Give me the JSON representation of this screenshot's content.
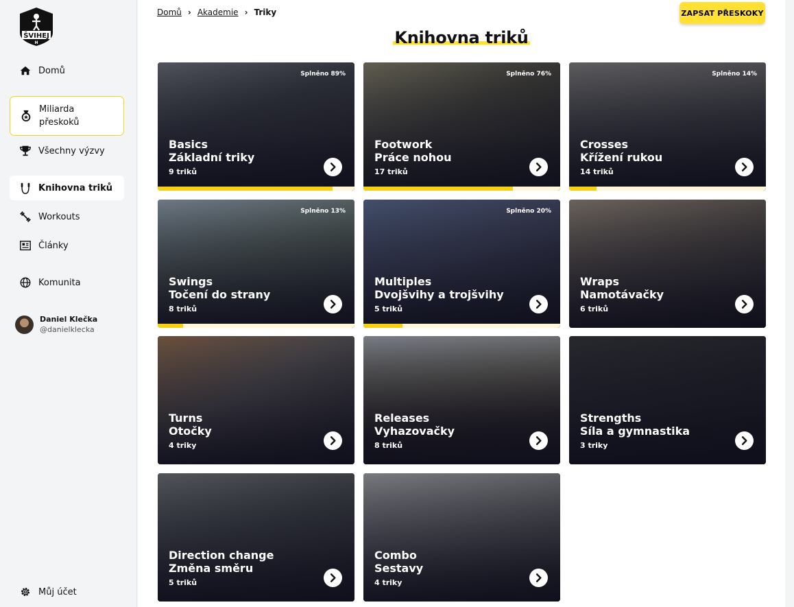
{
  "brand": {
    "logo_text": "ŠVIHEJ"
  },
  "sidebar": {
    "items": [
      {
        "label": "Domů",
        "icon": "home-icon"
      },
      {
        "label": "Miliarda přeskoků",
        "icon": "medal-icon"
      },
      {
        "label": "Všechny výzvy",
        "icon": "trophy-icon"
      },
      {
        "label": "Knihovna triků",
        "icon": "jump-rope-icon"
      },
      {
        "label": "Workouts",
        "icon": "dumbbell-icon"
      },
      {
        "label": "Články",
        "icon": "newspaper-icon"
      },
      {
        "label": "Komunita",
        "icon": "globe-icon"
      }
    ],
    "profile": {
      "name": "Daniel Klečka",
      "handle": "@danielklecka"
    },
    "account": {
      "label": "Můj účet",
      "icon": "settings-icon"
    }
  },
  "breadcrumb": {
    "home": "Domů",
    "academy": "Akademie",
    "current": "Triky"
  },
  "header": {
    "cta_label": "ZAPSAT PŘESKOKY",
    "title": "Knihovna triků"
  },
  "colors": {
    "accent": "#ffe033",
    "progress": "#f7cf13",
    "card_dark": "#15151f"
  },
  "cards": [
    {
      "title_en": "Basics",
      "title_cz": "Základní triky",
      "count": "9 triků",
      "progress_label": "Splněno 89%",
      "progress": 0.89
    },
    {
      "title_en": "Footwork",
      "title_cz": "Práce nohou",
      "count": "17 triků",
      "progress_label": "Splněno 76%",
      "progress": 0.76
    },
    {
      "title_en": "Crosses",
      "title_cz": "Křížení rukou",
      "count": "14 triků",
      "progress_label": "Splněno 14%",
      "progress": 0.14
    },
    {
      "title_en": "Swings",
      "title_cz": "Točení do strany",
      "count": "8 triků",
      "progress_label": "Splněno 13%",
      "progress": 0.13
    },
    {
      "title_en": "Multiples",
      "title_cz": "Dvojšvihy a trojšvihy",
      "count": "5 triků",
      "progress_label": "Splněno 20%",
      "progress": 0.2
    },
    {
      "title_en": "Wraps",
      "title_cz": "Namotávačky",
      "count": "6 triků",
      "progress_label": "",
      "progress": null
    },
    {
      "title_en": "Turns",
      "title_cz": "Otočky",
      "count": "4 triky",
      "progress_label": "",
      "progress": null
    },
    {
      "title_en": "Releases",
      "title_cz": "Vyhazovačky",
      "count": "8 triků",
      "progress_label": "",
      "progress": null
    },
    {
      "title_en": "Strengths",
      "title_cz": "Síla a gymnastika",
      "count": "3 triky",
      "progress_label": "",
      "progress": null
    },
    {
      "title_en": "Direction change",
      "title_cz": "Změna směru",
      "count": "5 triků",
      "progress_label": "",
      "progress": null
    },
    {
      "title_en": "Combo",
      "title_cz": "Sestavy",
      "count": "4 triky",
      "progress_label": "",
      "progress": null
    }
  ]
}
